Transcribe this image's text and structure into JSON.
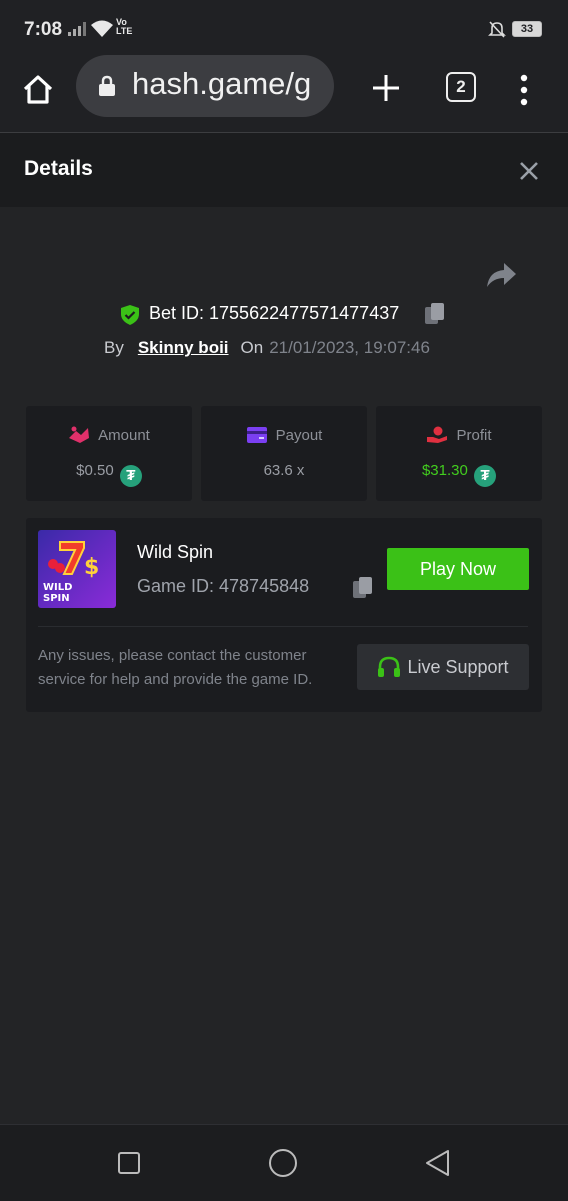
{
  "status_bar": {
    "time": "7:08",
    "volte_top": "Vo",
    "volte_bottom": "LTE",
    "battery": "33",
    "icons": [
      "signal-icon",
      "wifi-icon",
      "bell-off-icon",
      "battery-icon"
    ]
  },
  "browser": {
    "url": "hash.game/g",
    "tab_count": "2",
    "icons": [
      "home-icon",
      "lock-icon",
      "plus-icon",
      "menu-dots-icon"
    ]
  },
  "details": {
    "title": "Details",
    "close_icon": "close-icon"
  },
  "bet": {
    "bet_id_label": "Bet ID: 1755622477571477437",
    "by_label": "By",
    "user": "Skinny boii",
    "on_label": "On",
    "date": "21/01/2023, 19:07:46"
  },
  "stats": [
    {
      "label": "Amount",
      "value": "$0.50",
      "icon": "amount-icon",
      "color": "#e0306a",
      "has_tether": true
    },
    {
      "label": "Payout",
      "value": "63.6 x",
      "icon": "wallet-icon",
      "color": "#7b3ff2",
      "has_tether": false
    },
    {
      "label": "Profit",
      "value": "$31.30",
      "icon": "profit-icon",
      "color": "#e03040",
      "has_tether": true
    }
  ],
  "game": {
    "name": "Wild Spin",
    "game_id_label": "Game ID: 478745848",
    "thumb_text_line1": "WILD",
    "thumb_text_line2": "SPIN",
    "play_label": "Play Now",
    "issues_text": "Any issues, please contact the customer service for help and provide the game ID.",
    "support_label": "Live Support"
  },
  "colors": {
    "accent_green": "#3bc117",
    "profit_green": "#42cc1f",
    "tether": "#26a17b",
    "background": "#232426"
  },
  "nav": {
    "icons": [
      "recents-icon",
      "home-circle-icon",
      "back-icon"
    ]
  }
}
